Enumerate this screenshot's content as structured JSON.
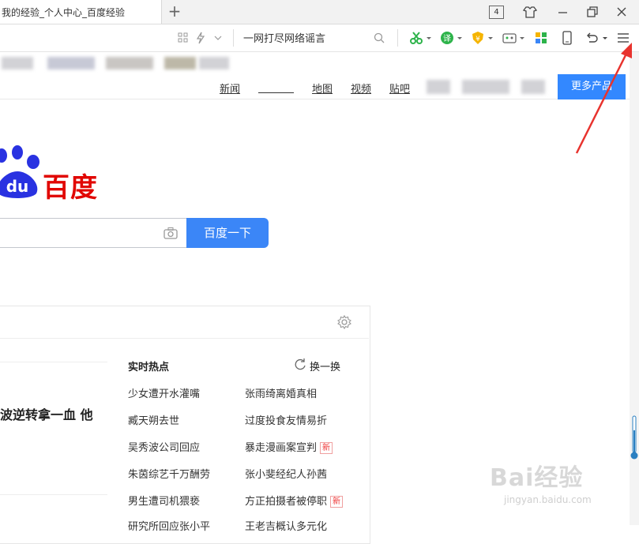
{
  "tab": {
    "title": "我的经验_个人中心_百度经验",
    "new_tab": "+",
    "count": "4"
  },
  "toolbar": {
    "address_search": "一网打尽网络谣言"
  },
  "nav": {
    "links": [
      "新闻",
      "地图",
      "视频",
      "贴吧"
    ],
    "more_products": "更多产品"
  },
  "logo": {
    "du": "du",
    "text": "百度"
  },
  "search": {
    "button": "百度一下"
  },
  "hot": {
    "title": "实时热点",
    "refresh": "换一换",
    "new_badge": "新",
    "left": [
      "少女遭开水灌嘴",
      "臧天朔去世",
      "吴秀波公司回应",
      "朱茵综艺千万酬劳",
      "男生遭司机猥亵",
      "研究所回应张小平"
    ],
    "right": [
      "张雨绮离婚真相",
      "过度投食友情易折",
      "暴走漫画案宣判",
      "张小斐经纪人孙茜",
      "方正拍摄者被停职",
      "王老吉概认多元化"
    ]
  },
  "news": {
    "headline": "波逆转拿一血 他"
  },
  "watermark": {
    "brand": "Bai经验",
    "url": "jingyan.baidu.com"
  },
  "colors": {
    "accent_blue": "#3388ff",
    "baidu_red": "#e10602",
    "baidu_blue": "#2932e1",
    "arrow_red": "#e8332e"
  }
}
